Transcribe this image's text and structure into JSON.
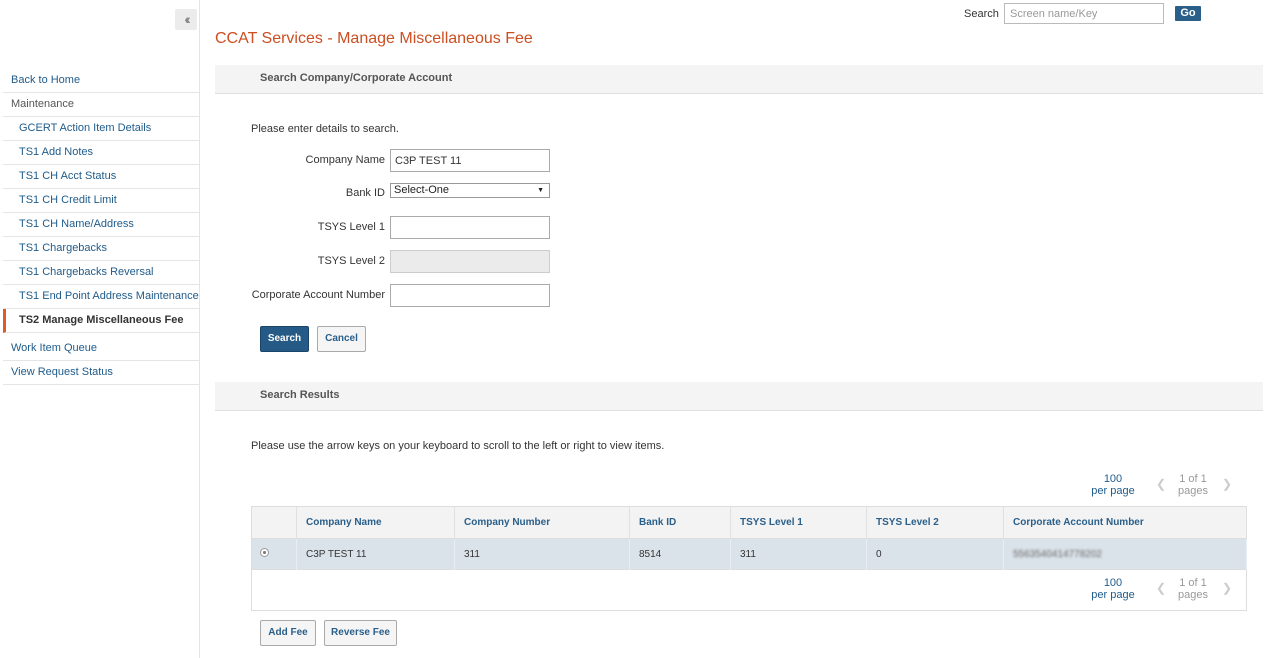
{
  "sidebar": {
    "collapse_icon": "double-chevron-left-icon",
    "items": [
      {
        "label": "Back to Home",
        "type": "link"
      },
      {
        "label": "Maintenance",
        "type": "header"
      },
      {
        "label": "GCERT Action Item Details",
        "type": "sub"
      },
      {
        "label": "TS1 Add Notes",
        "type": "sub"
      },
      {
        "label": "TS1 CH Acct Status",
        "type": "sub"
      },
      {
        "label": "TS1 CH Credit Limit",
        "type": "sub"
      },
      {
        "label": "TS1 CH Name/Address",
        "type": "sub"
      },
      {
        "label": "TS1 Chargebacks",
        "type": "sub"
      },
      {
        "label": "TS1 Chargebacks Reversal",
        "type": "sub"
      },
      {
        "label": "TS1 End Point Address Maintenance",
        "type": "sub"
      },
      {
        "label": "TS2 Manage Miscellaneous Fee",
        "type": "sub-active"
      },
      {
        "label": "Work Item Queue",
        "type": "link"
      },
      {
        "label": "View Request Status",
        "type": "link"
      }
    ]
  },
  "header": {
    "search_label": "Search",
    "search_placeholder": "Screen name/Key",
    "go_label": "Go"
  },
  "page": {
    "title": "CCAT Services - Manage Miscellaneous Fee"
  },
  "search_form": {
    "section_title": "Search Company/Corporate Account",
    "instruction": "Please enter details to search.",
    "company_name_label": "Company Name",
    "company_name_value": "C3P TEST 11",
    "bank_id_label": "Bank ID",
    "bank_id_value": "Select-One",
    "tsys_level1_label": "TSYS Level 1",
    "tsys_level1_value": "",
    "tsys_level2_label": "TSYS Level 2",
    "tsys_level2_value": "",
    "corporate_account_label": "Corporate Account Number",
    "corporate_account_value": "",
    "search_button": "Search",
    "cancel_button": "Cancel"
  },
  "results": {
    "section_title": "Search Results",
    "instruction": "Please use the arrow keys on your keyboard to scroll to the left or right to view items.",
    "pager": {
      "per_page_value": "100",
      "per_page_label": "per page",
      "pages_value": "1 of 1",
      "pages_label": "pages"
    },
    "columns": [
      "",
      "Company Name",
      "Company Number",
      "Bank ID",
      "TSYS Level 1",
      "TSYS Level 2",
      "Corporate Account Number"
    ],
    "rows": [
      {
        "company_name": "C3P TEST 11",
        "company_number": "311",
        "bank_id": "8514",
        "tsys_level1": "311",
        "tsys_level2": "0",
        "corporate_account": "5563540414778202"
      }
    ],
    "add_fee_button": "Add Fee",
    "reverse_fee_button": "Reverse Fee"
  }
}
